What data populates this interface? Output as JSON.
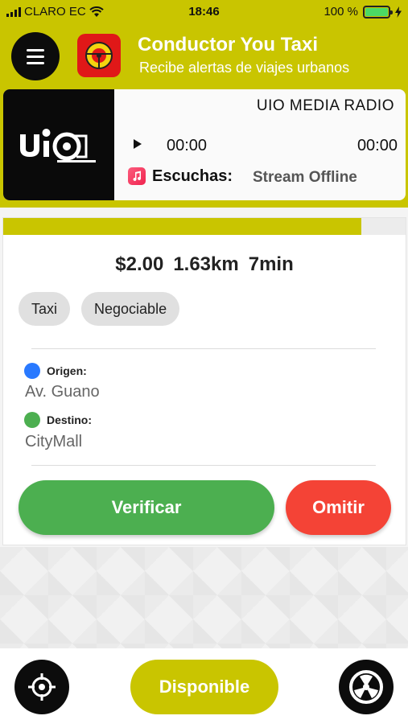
{
  "status_bar": {
    "carrier": "CLARO EC",
    "time": "18:46",
    "battery_text": "100 %",
    "battery_level": 1.0
  },
  "header": {
    "title": "Conductor You Taxi",
    "subtitle": "Recibe alertas de viajes urbanos",
    "background_color": "#c9c500"
  },
  "player": {
    "station_name": "UIO MEDIA RADIO",
    "current_time": "00:00",
    "total_time": "00:00",
    "listeners_label": "Escuchas:",
    "stream_status": "Stream Offline",
    "logo_icon": "uio-media-logo"
  },
  "trip": {
    "progress": 0.89,
    "price": "$2.00",
    "distance": "1.63km",
    "duration": "7min",
    "chips": [
      "Taxi",
      "Negociable"
    ],
    "origin_label": "Origen:",
    "origin_value": "Av. Guano",
    "destination_label": "Destino:",
    "destination_value": "CityMall",
    "origin_color": "#2979ff",
    "destination_color": "#4caf50",
    "verify_label": "Verificar",
    "skip_label": "Omitir",
    "verify_color": "#4caf50",
    "skip_color": "#f44336"
  },
  "bottom": {
    "available_label": "Disponible",
    "left_icon": "crosshair-icon",
    "right_icon": "steering-wheel-icon"
  }
}
